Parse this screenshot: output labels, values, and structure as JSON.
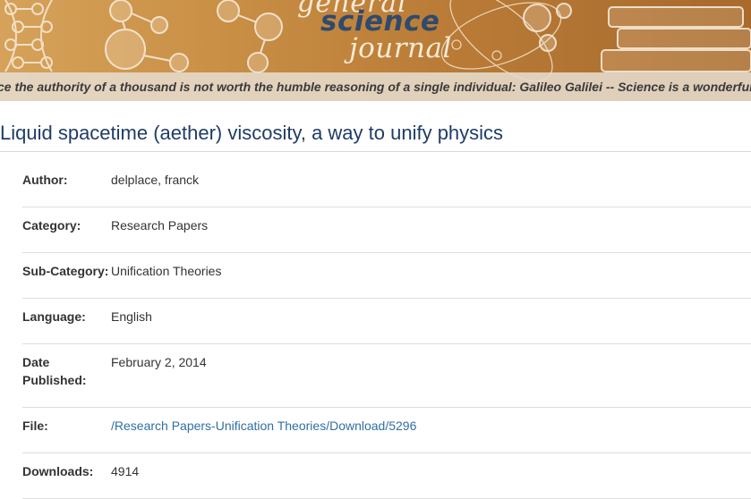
{
  "banner": {
    "logo": {
      "general": "general",
      "science": "science",
      "journal": "journal"
    },
    "ticker": "ce the authority of a thousand is not worth the humble reasoning of a single individual: Galileo Galilei -- Science is a wonderful"
  },
  "article": {
    "title": "Liquid spacetime (aether) viscosity, a way to unify physics"
  },
  "details": {
    "author": {
      "label": "Author:",
      "value": "delplace, franck"
    },
    "category": {
      "label": "Category:",
      "value": "Research Papers"
    },
    "subcategory": {
      "label": "Sub-Category:",
      "value": "Unification Theories"
    },
    "language": {
      "label": "Language:",
      "value": "English"
    },
    "date_published": {
      "label_line1": "Date",
      "label_line2": "Published:",
      "value": "February 2, 2014"
    },
    "file": {
      "label": "File:",
      "value": "/Research Papers-Unification Theories/Download/5296"
    },
    "downloads": {
      "label": "Downloads:",
      "value": "4914"
    }
  },
  "colors": {
    "title": "#1f3d66",
    "link": "#2f6fa5",
    "banner": "#c98f45",
    "logo_science": "#2f4a6e"
  }
}
